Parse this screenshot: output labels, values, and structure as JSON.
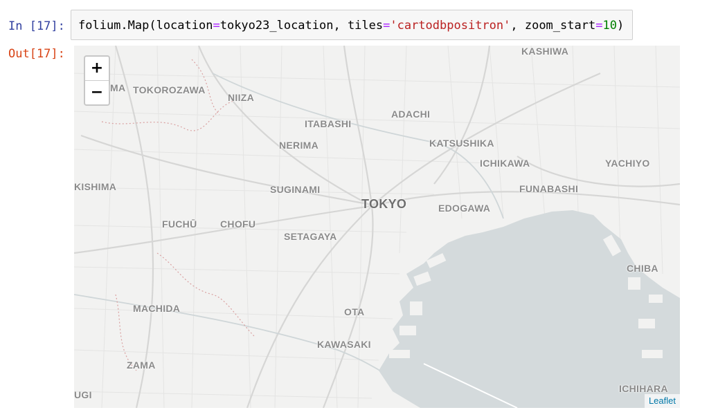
{
  "cell": {
    "in_prompt": "In [17]:",
    "out_prompt": "Out[17]:",
    "code": {
      "fn": "folium.Map(location",
      "eq1": "=",
      "location_var": "tokyo23_location, tiles",
      "eq2": "=",
      "tiles_value": "'cartodbpositron'",
      "sep": ", zoom_start",
      "eq3": "=",
      "zoom_value": "10",
      "close": ")"
    }
  },
  "map": {
    "zoom_in": "+",
    "zoom_out": "−",
    "attribution": "Leaflet",
    "places": {
      "tokyo": "TOKYO",
      "kashiwa": "KASHIWA",
      "tokorozawa": "TOKOROZAWA",
      "niiza": "NIIZA",
      "adachi": "ADACHI",
      "itabashi": "ITABASHI",
      "nerima": "NERIMA",
      "katsushika": "KATSUSHIKA",
      "ichikawa": "ICHIKAWA",
      "yachiyo": "YACHIYO",
      "kishima": "KISHIMA",
      "suginami": "SUGINAMI",
      "funabashi": "FUNABASHI",
      "edogawa": "EDOGAWA",
      "fuchu": "FUCHŪ",
      "chofu": "CHOFU",
      "setagaya": "SETAGAYA",
      "chiba": "CHIBA",
      "machida": "MACHIDA",
      "ota": "OTA",
      "kawasaki": "KAWASAKI",
      "zama": "ZAMA",
      "ichihara": "ICHIHARA",
      "ugi": "UGI",
      "ma": "MA"
    },
    "colors": {
      "land": "#f2f2f1",
      "water": "#d4dadc",
      "roads": "#ffffff",
      "road_casing": "#dcdcdc",
      "boundary": "#d9a0a0"
    }
  }
}
